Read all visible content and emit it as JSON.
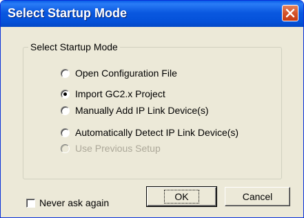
{
  "window": {
    "title": "Select Startup Mode",
    "title_bar_color": "#0451d9",
    "close_icon": "close-x-icon",
    "close_button_color": "#d4542b"
  },
  "group": {
    "label": "Select Startup Mode"
  },
  "options": [
    {
      "label": "Open Configuration File",
      "checked": false,
      "enabled": true
    },
    {
      "label": "Import GC2.x Project",
      "checked": true,
      "enabled": true
    },
    {
      "label": "Manually Add IP Link Device(s)",
      "checked": false,
      "enabled": true
    },
    {
      "label": "Automatically Detect IP Link Device(s)",
      "checked": false,
      "enabled": true
    },
    {
      "label": "Use Previous Setup",
      "checked": false,
      "enabled": false
    }
  ],
  "never_ask": {
    "label": "Never ask again",
    "checked": false
  },
  "buttons": {
    "ok": "OK",
    "cancel": "Cancel"
  }
}
